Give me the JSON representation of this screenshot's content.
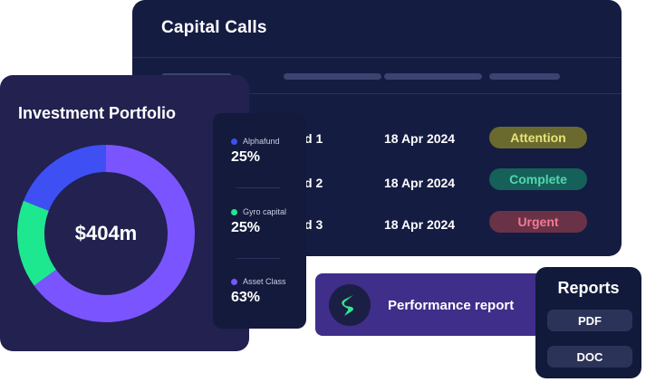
{
  "capital_calls": {
    "title": "Capital Calls",
    "rows": [
      {
        "fund": "d 1",
        "date": "18 Apr 2024",
        "status": "Attention",
        "status_bg": "#6b6a2e",
        "status_fg": "#e6e27a"
      },
      {
        "fund": "d 2",
        "date": "18 Apr 2024",
        "status": "Complete",
        "status_bg": "#16605a",
        "status_fg": "#53d6ad"
      },
      {
        "fund": "d 3",
        "date": "18 Apr 2024",
        "status": "Urgent",
        "status_bg": "#6a3247",
        "status_fg": "#f27a95"
      }
    ]
  },
  "portfolio": {
    "title": "Investment Portfolio",
    "total": "$404m",
    "segments": [
      {
        "color": "#7a55ff",
        "fraction": 0.65
      },
      {
        "color": "#1ee88f",
        "fraction": 0.16
      },
      {
        "color": "#3e4ff4",
        "fraction": 0.19
      }
    ]
  },
  "legend": [
    {
      "name": "Alphafund",
      "value": "25%",
      "color": "#3e4ff4"
    },
    {
      "name": "Gyro capital",
      "value": "25%",
      "color": "#1ee88f"
    },
    {
      "name": "Asset Class",
      "value": "63%",
      "color": "#7a55ff"
    }
  ],
  "performance": {
    "label": "Performance report",
    "logo_color": "#2ee88f"
  },
  "reports": {
    "title": "Reports",
    "buttons": [
      "PDF",
      "DOC"
    ]
  }
}
